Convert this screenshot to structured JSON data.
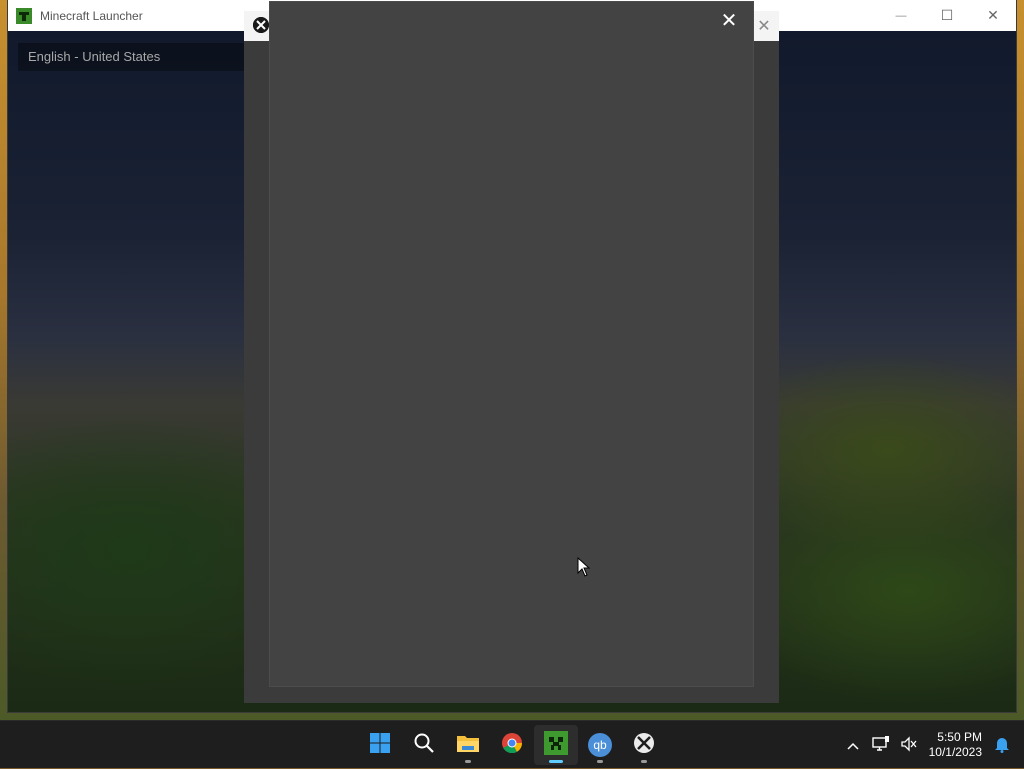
{
  "launcher": {
    "title": "Minecraft Launcher",
    "language": "English - United States",
    "controls": {
      "minimize": "—",
      "maximize": "☐",
      "close": "✕"
    }
  },
  "xbox_dialog": {
    "outer_close": "✕",
    "inner_close": "✕"
  },
  "taskbar": {
    "apps": [
      "start-icon",
      "search-icon",
      "file-explorer-icon",
      "chrome-icon",
      "minecraft-launcher-icon",
      "qbittorrent-icon",
      "xbox-icon"
    ],
    "active_app": "minecraft-launcher-icon",
    "qb_label": "qb",
    "time": "5:50 PM",
    "date": "10/1/2023"
  },
  "colors": {
    "taskbar_bg": "#1e1e1e",
    "dialog_bg": "#434343",
    "accent": "#60cdff"
  }
}
